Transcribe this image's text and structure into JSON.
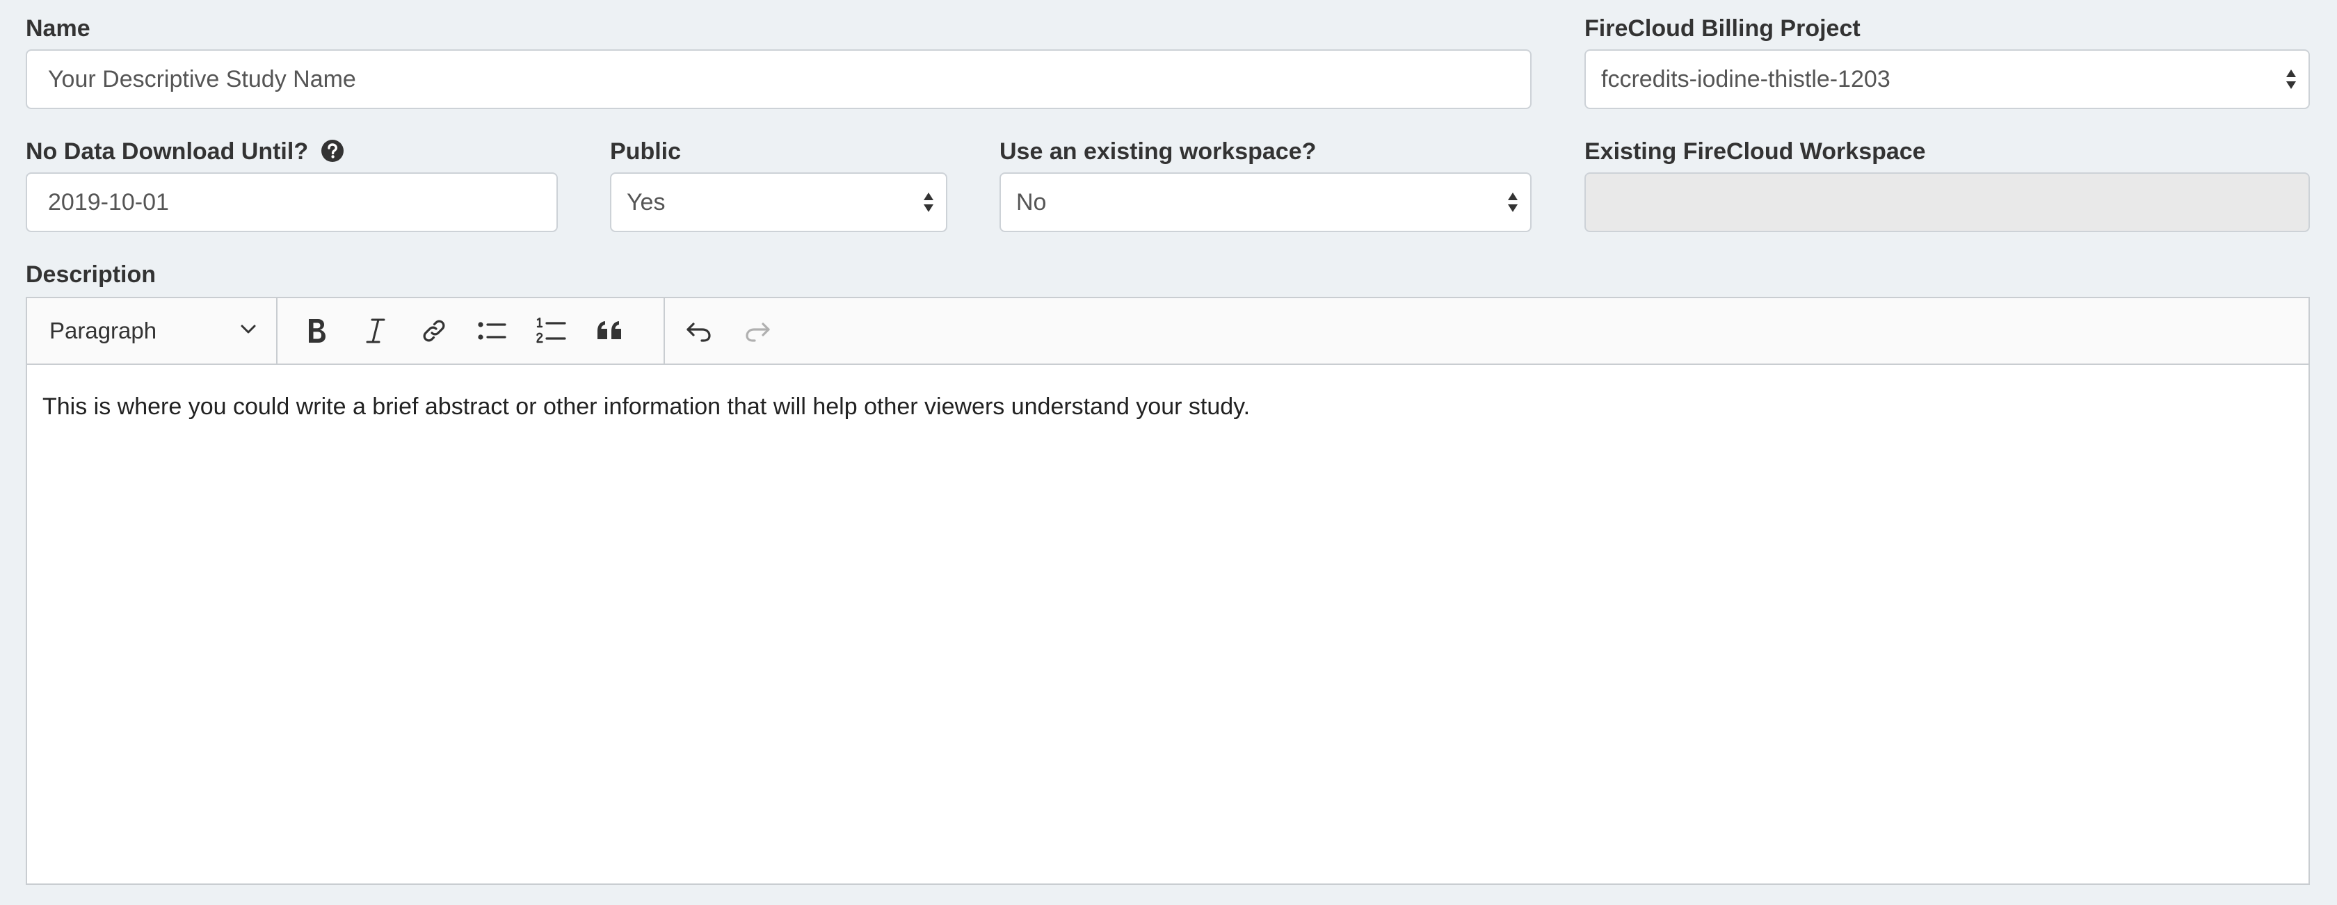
{
  "form": {
    "name": {
      "label": "Name",
      "placeholder": "Your Descriptive Study Name"
    },
    "billing_project": {
      "label": "FireCloud Billing Project",
      "selected": "fccredits-iodine-thistle-1203"
    },
    "no_download": {
      "label": "No Data Download Until?",
      "value": "2019-10-01"
    },
    "public": {
      "label": "Public",
      "selected": "Yes"
    },
    "use_existing": {
      "label": "Use an existing workspace?",
      "selected": "No"
    },
    "existing_workspace": {
      "label": "Existing FireCloud Workspace",
      "value": ""
    },
    "description": {
      "label": "Description",
      "format": "Paragraph",
      "text": "This is where you could write a brief abstract or other information that will help other viewers understand your study."
    }
  },
  "toolbar_icons": [
    "bold-icon",
    "italic-icon",
    "link-icon",
    "bulleted-list-icon",
    "numbered-list-icon",
    "blockquote-icon",
    "undo-icon",
    "redo-icon"
  ],
  "colors": {
    "background": "#edf1f4",
    "input_border": "#cdd2d7",
    "disabled_bg": "#e9e9e9",
    "redo_disabled": "#b0b0b0"
  }
}
